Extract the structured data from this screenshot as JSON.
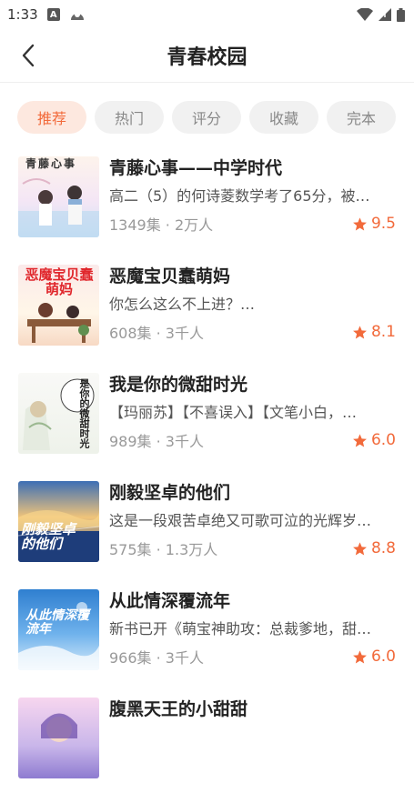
{
  "status": {
    "time": "1:33"
  },
  "header": {
    "title": "青春校园"
  },
  "tabs": [
    {
      "label": "推荐",
      "active": true
    },
    {
      "label": "热门",
      "active": false
    },
    {
      "label": "评分",
      "active": false
    },
    {
      "label": "收藏",
      "active": false
    },
    {
      "label": "完本",
      "active": false
    }
  ],
  "books": [
    {
      "title": "青藤心事——中学时代",
      "desc": "高二（5）的何诗菱数学考了65分，被…",
      "count": "1349集 · 2万人",
      "score": "9.5",
      "cover_text": "青藤心事"
    },
    {
      "title": "恶魔宝贝蠢萌妈",
      "desc": "你怎么这么不上进？…",
      "count": "608集 · 3千人",
      "score": "8.1",
      "cover_text": "恶魔宝贝蠢萌妈"
    },
    {
      "title": "我是你的微甜时光",
      "desc": "【玛丽苏】【不喜误入】【文笔小白，…",
      "count": "989集 · 3千人",
      "score": "6.0",
      "cover_text": "是你的微甜时光"
    },
    {
      "title": "刚毅坚卓的他们",
      "desc": "这是一段艰苦卓绝又可歌可泣的光辉岁…",
      "count": "575集 · 1.3万人",
      "score": "8.8",
      "cover_text": "刚毅坚卓的他们"
    },
    {
      "title": "从此情深覆流年",
      "desc": "新书已开《萌宝神助攻：总裁爹地，甜…",
      "count": "966集 · 3千人",
      "score": "6.0",
      "cover_text": "从此情深覆流年"
    },
    {
      "title": "腹黑天王的小甜甜",
      "desc": "",
      "count": "",
      "score": "",
      "cover_text": ""
    }
  ]
}
